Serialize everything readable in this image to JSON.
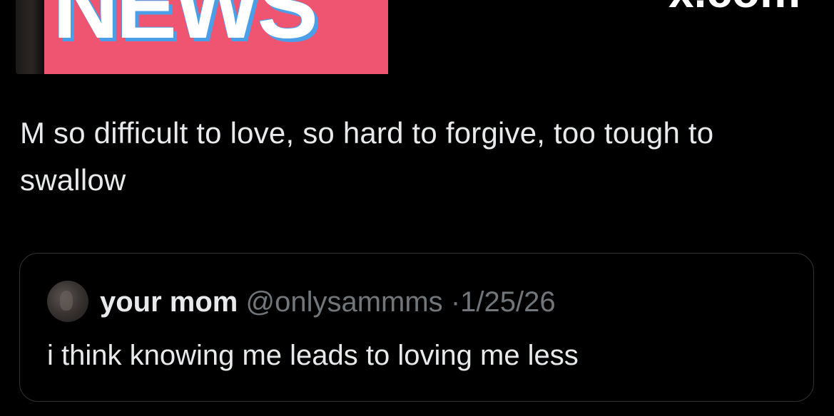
{
  "link_card": {
    "image_word": "NEWS",
    "domain": "x.com",
    "accent_color": "#ef5470",
    "shadow_color": "#4b9fe8"
  },
  "tweet": {
    "text": "M so difficult to love, so hard to forgive, too tough to swallow"
  },
  "quoted_tweet": {
    "display_name": "your mom",
    "handle": "@onlysammms",
    "separator": "·",
    "date": "1/25/26",
    "text": "i think knowing me leads to loving me less",
    "avatar_icon": "profile-avatar"
  }
}
